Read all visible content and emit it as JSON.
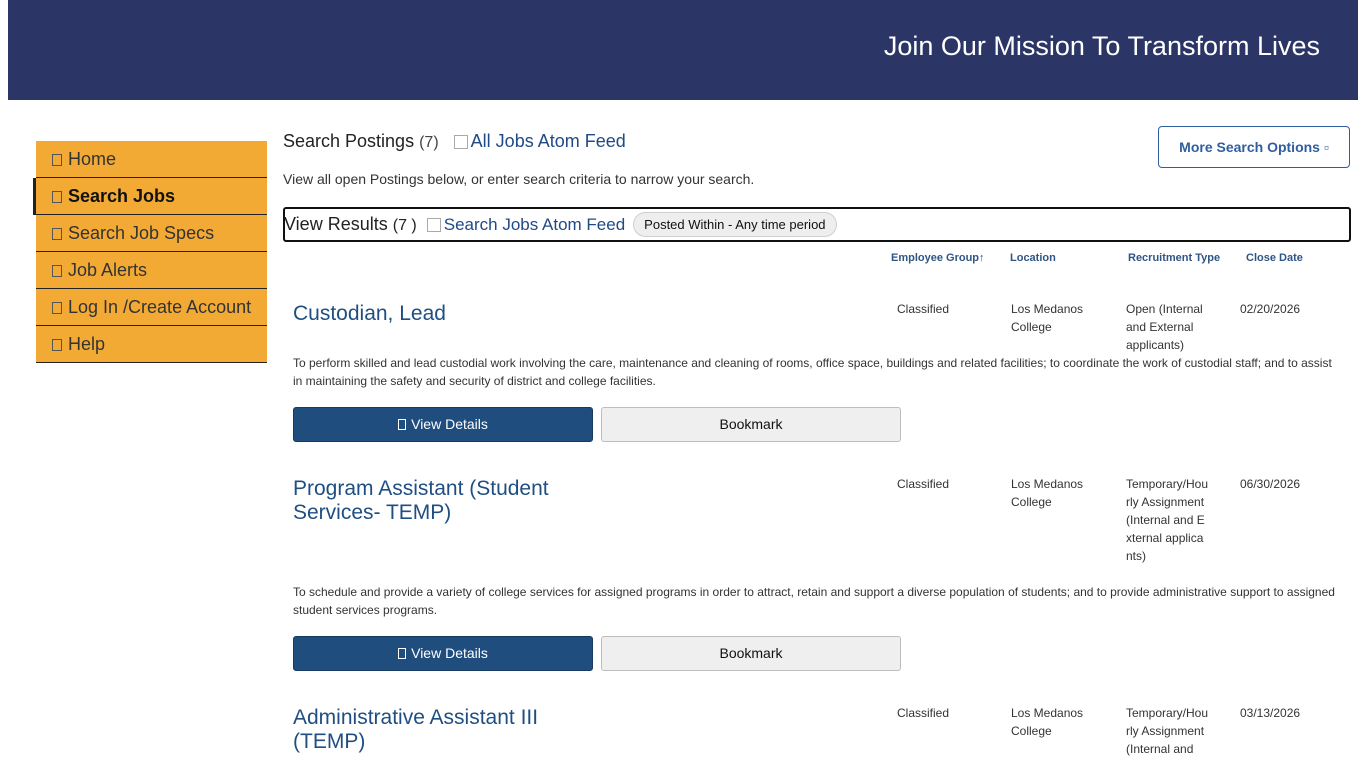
{
  "header": {
    "title": "Join Our Mission To Transform Lives",
    "background": "#2b3566"
  },
  "sidebar": {
    "items": [
      {
        "label": "Home",
        "icon": "home-icon"
      },
      {
        "label": "Search Jobs",
        "icon": "search-icon"
      },
      {
        "label": "Search Job Specs",
        "icon": "search-icon"
      },
      {
        "label": "Job Alerts",
        "icon": "bell-icon"
      },
      {
        "label": "Log In /Create Account",
        "icon": "user-icon"
      },
      {
        "label": "Help",
        "icon": "question-icon"
      }
    ],
    "active_index": 1,
    "color": "#f3aa34"
  },
  "search": {
    "title": "Search Postings",
    "count": "(7)",
    "feed_label": "All Jobs Atom Feed",
    "subtitle": "View all open Postings below, or enter search criteria to narrow your search.",
    "more_options": "More Search Options"
  },
  "results": {
    "title": "View Results",
    "count": "(7 )",
    "feed_label": "Search Jobs Atom Feed",
    "filter_pill": "Posted Within - Any time period"
  },
  "columns": {
    "employee_group": "Employee Group↑",
    "location": "Location",
    "recruitment_type": "Recruitment Type",
    "close_date": "Close Date"
  },
  "buttons": {
    "view_details": "View Details",
    "bookmark": "Bookmark"
  },
  "jobs": [
    {
      "title": "Custodian, Lead",
      "employee_group": "Classified",
      "location": "Los Medanos College",
      "recruitment_type": "Open (Internal and External applicants)",
      "close_date": "02/20/2026",
      "description": "To perform skilled and lead custodial work involving the care, maintenance and cleaning of rooms, office space, buildings and related facilities; to coordinate the work of custodial staff; and to assist in maintaining the safety and security of district and college facilities."
    },
    {
      "title": "Program Assistant (Student Services- TEMP)",
      "employee_group": "Classified",
      "location": "Los Medanos College",
      "recruitment_type": "Temporary/Hourly Assignment (Internal and External applicants)",
      "close_date": "06/30/2026",
      "description": "To schedule and provide a variety of college services for assigned programs in order to attract, retain and support a diverse population of students; and to provide administrative support to assigned student services programs."
    },
    {
      "title": "Administrative Assistant III (TEMP)",
      "employee_group": "Classified",
      "location": "Los Medanos College",
      "recruitment_type": "Temporary/Hourly Assignment (Internal and",
      "close_date": "03/13/2026",
      "description": ""
    }
  ]
}
